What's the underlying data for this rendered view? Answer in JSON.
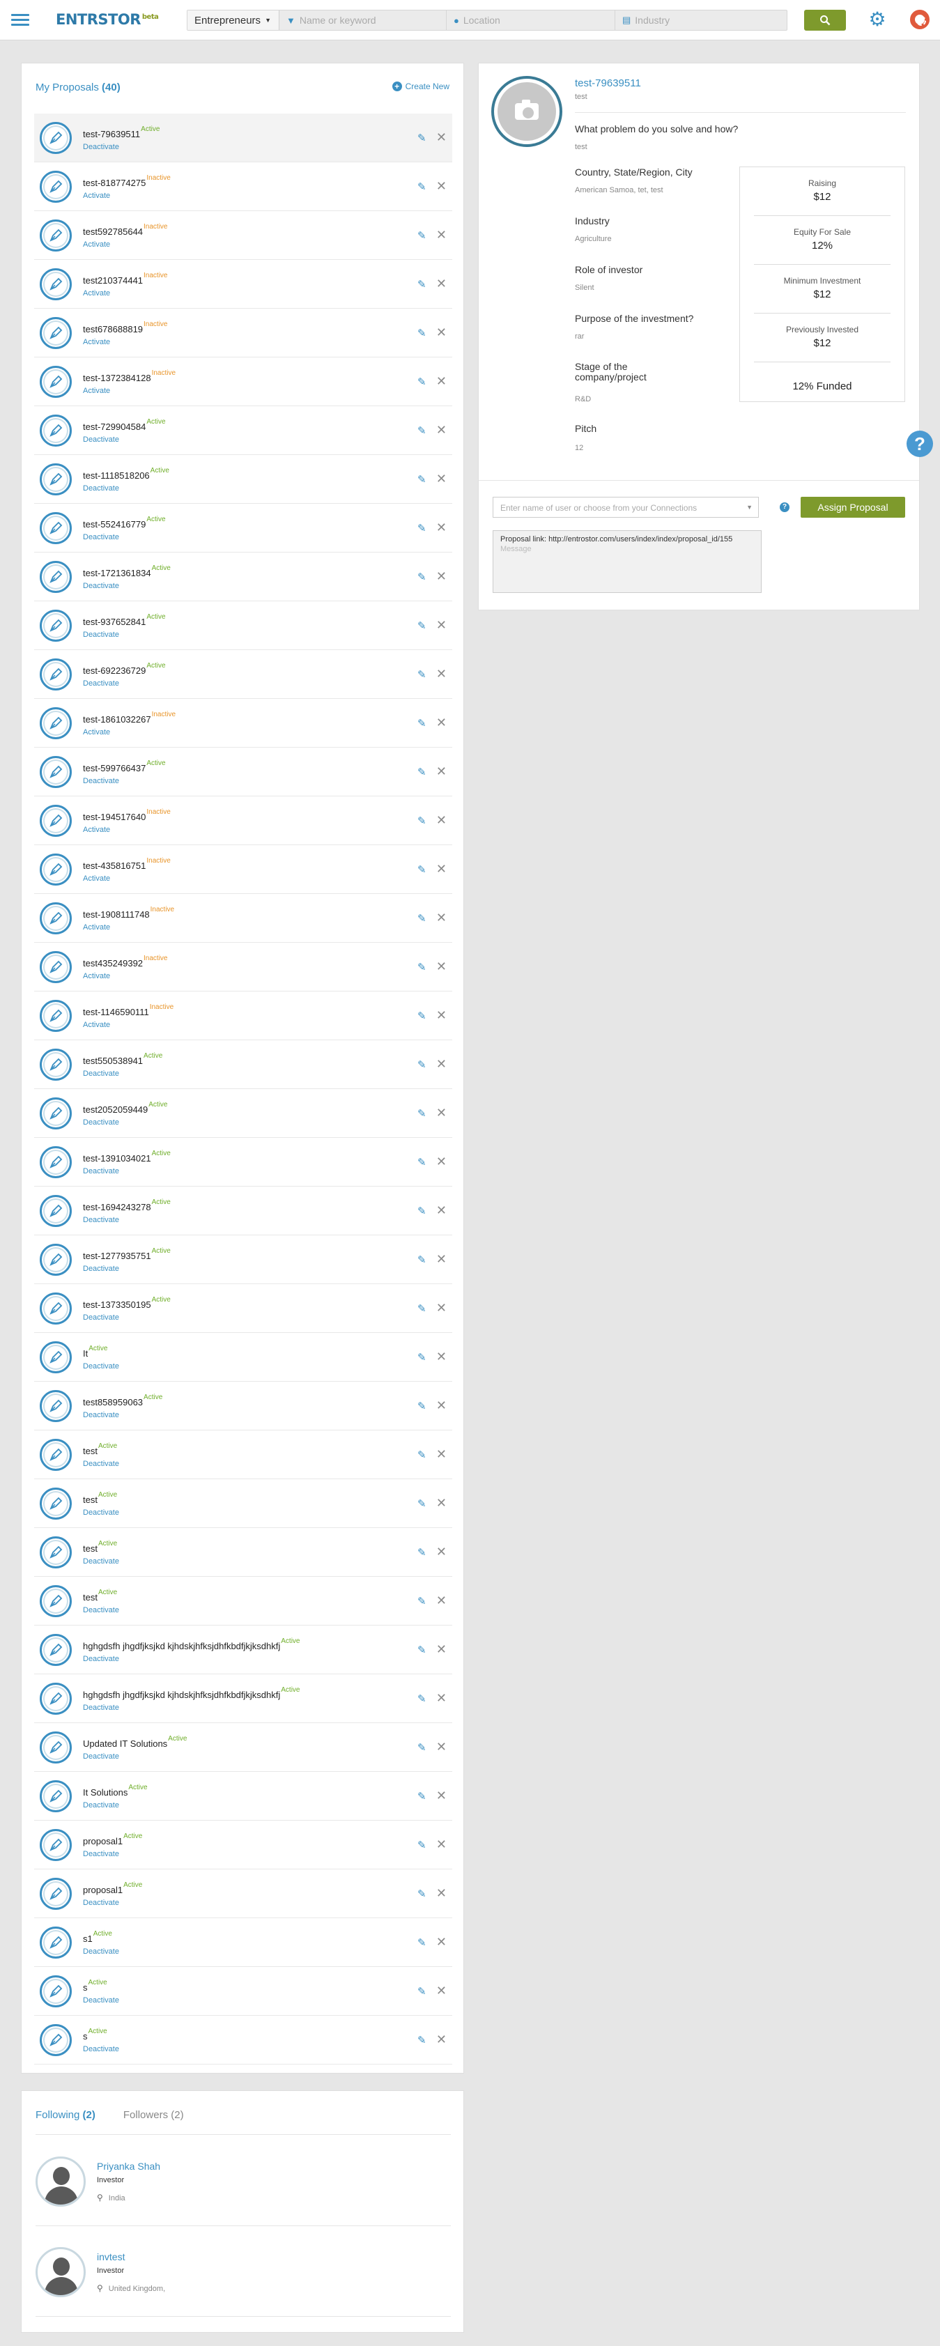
{
  "header": {
    "logo": "ENTRSTOR",
    "logo_beta": "beta",
    "category": "Entrepreneurs",
    "search_placeholder": "Name or keyword",
    "location_placeholder": "Location",
    "industry_placeholder": "Industry"
  },
  "proposals": {
    "title": "My Proposals",
    "count": "(40)",
    "create_new": "Create New",
    "items": [
      {
        "name": "test-79639511",
        "status": "Active",
        "toggle": "Deactivate"
      },
      {
        "name": "test-818774275",
        "status": "Inactive",
        "toggle": "Activate"
      },
      {
        "name": "test592785644",
        "status": "Inactive",
        "toggle": "Activate"
      },
      {
        "name": "test210374441",
        "status": "Inactive",
        "toggle": "Activate"
      },
      {
        "name": "test678688819",
        "status": "Inactive",
        "toggle": "Activate"
      },
      {
        "name": "test-1372384128",
        "status": "Inactive",
        "toggle": "Activate"
      },
      {
        "name": "test-729904584",
        "status": "Active",
        "toggle": "Deactivate"
      },
      {
        "name": "test-1118518206",
        "status": "Active",
        "toggle": "Deactivate"
      },
      {
        "name": "test-552416779",
        "status": "Active",
        "toggle": "Deactivate"
      },
      {
        "name": "test-1721361834",
        "status": "Active",
        "toggle": "Deactivate"
      },
      {
        "name": "test-937652841",
        "status": "Active",
        "toggle": "Deactivate"
      },
      {
        "name": "test-692236729",
        "status": "Active",
        "toggle": "Deactivate"
      },
      {
        "name": "test-1861032267",
        "status": "Inactive",
        "toggle": "Activate"
      },
      {
        "name": "test-599766437",
        "status": "Active",
        "toggle": "Deactivate"
      },
      {
        "name": "test-194517640",
        "status": "Inactive",
        "toggle": "Activate"
      },
      {
        "name": "test-435816751",
        "status": "Inactive",
        "toggle": "Activate"
      },
      {
        "name": "test-1908111748",
        "status": "Inactive",
        "toggle": "Activate"
      },
      {
        "name": "test435249392",
        "status": "Inactive",
        "toggle": "Activate"
      },
      {
        "name": "test-1146590111",
        "status": "Inactive",
        "toggle": "Activate"
      },
      {
        "name": "test550538941",
        "status": "Active",
        "toggle": "Deactivate"
      },
      {
        "name": "test2052059449",
        "status": "Active",
        "toggle": "Deactivate"
      },
      {
        "name": "test-1391034021",
        "status": "Active",
        "toggle": "Deactivate"
      },
      {
        "name": "test-1694243278",
        "status": "Active",
        "toggle": "Deactivate"
      },
      {
        "name": "test-1277935751",
        "status": "Active",
        "toggle": "Deactivate"
      },
      {
        "name": "test-1373350195",
        "status": "Active",
        "toggle": "Deactivate"
      },
      {
        "name": "It",
        "status": "Active",
        "toggle": "Deactivate"
      },
      {
        "name": "test858959063",
        "status": "Active",
        "toggle": "Deactivate"
      },
      {
        "name": "test",
        "status": "Active",
        "toggle": "Deactivate"
      },
      {
        "name": "test",
        "status": "Active",
        "toggle": "Deactivate"
      },
      {
        "name": "test",
        "status": "Active",
        "toggle": "Deactivate"
      },
      {
        "name": "test",
        "status": "Active",
        "toggle": "Deactivate"
      },
      {
        "name": "hghgdsfh jhgdfjksjkd kjhdskjhfksjdhfkbdfjkjksdhkfj",
        "status": "Active",
        "toggle": "Deactivate"
      },
      {
        "name": "hghgdsfh jhgdfjksjkd kjhdskjhfksjdhfkbdfjkjksdhkfj",
        "status": "Active",
        "toggle": "Deactivate"
      },
      {
        "name": "Updated IT Solutions",
        "status": "Active",
        "toggle": "Deactivate"
      },
      {
        "name": "It Solutions",
        "status": "Active",
        "toggle": "Deactivate"
      },
      {
        "name": "proposal1",
        "status": "Active",
        "toggle": "Deactivate"
      },
      {
        "name": "proposal1",
        "status": "Active",
        "toggle": "Deactivate"
      },
      {
        "name": "s1",
        "status": "Active",
        "toggle": "Deactivate"
      },
      {
        "name": "s",
        "status": "Active",
        "toggle": "Deactivate"
      },
      {
        "name": "s",
        "status": "Active",
        "toggle": "Deactivate"
      }
    ]
  },
  "detail": {
    "title": "test-79639511",
    "subtitle": "test",
    "q1_label": "What problem do you solve and how?",
    "q1_value": "test",
    "q2_label": "Country, State/Region, City",
    "q2_value": "American Samoa, tet, test",
    "q3_label": "Industry",
    "q3_value": "Agriculture",
    "q4_label": "Role of investor",
    "q4_value": "Silent",
    "q5_label": "Purpose of the investment?",
    "q5_value": "rar",
    "q6_label": "Stage of the company/project",
    "q6_value": "R&D",
    "q7_label": "Pitch",
    "q7_value": "12",
    "stats": {
      "raising_label": "Raising",
      "raising_value": "$12",
      "equity_label": "Equity For Sale",
      "equity_value": "12%",
      "min_label": "Minimum Investment",
      "min_value": "$12",
      "prev_label": "Previously Invested",
      "prev_value": "$12",
      "funded": "12% Funded"
    },
    "assign_placeholder": "Enter name of user or choose from your Connections",
    "assign_button": "Assign Proposal",
    "message_link": "Proposal link: http://entrostor.com/users/index/index/proposal_id/155",
    "message_placeholder": "Message"
  },
  "follow": {
    "following_label": "Following",
    "following_count": "(2)",
    "followers_label": "Followers",
    "followers_count": "(2)",
    "items": [
      {
        "name": "Priyanka Shah",
        "role": "Investor",
        "location": "India"
      },
      {
        "name": "invtest",
        "role": "Investor",
        "location": "United Kingdom,"
      }
    ]
  },
  "colors": {
    "accent": "#3a8fc2",
    "active": "#6fae2a",
    "inactive": "#e8952b",
    "button": "#7e9a2c"
  }
}
